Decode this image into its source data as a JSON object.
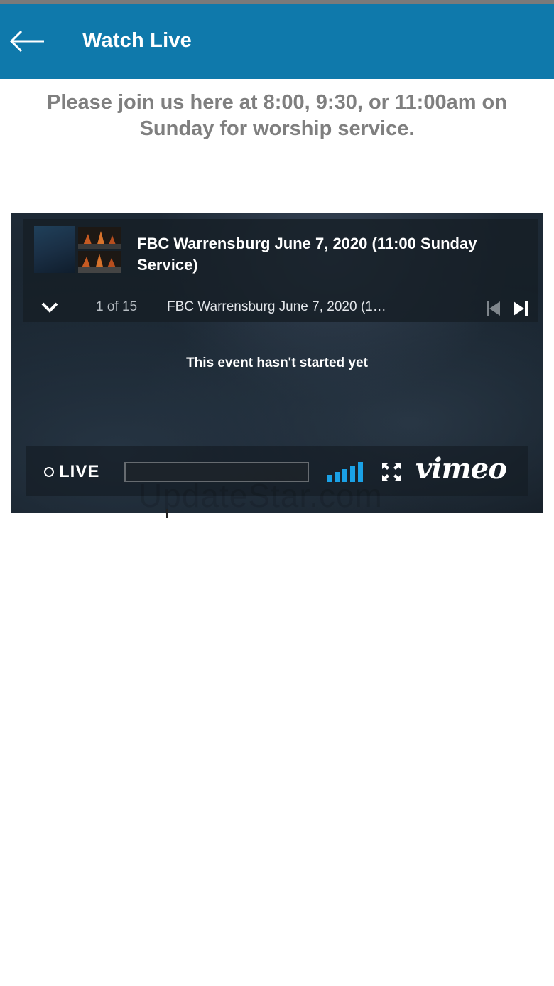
{
  "app_bar": {
    "title": "Watch Live",
    "back_icon": "arrow-left-icon",
    "bg_color": "#0f79ab"
  },
  "intro_text": "Please join us here at 8:00, 9:30, or 11:00am on Sunday for worship service.",
  "player": {
    "video_title": "FBC Warrensburg June 7, 2020 (11:00 Sunday Service)",
    "playlist_counter": "1 of 15",
    "playlist_item_title": "FBC Warrensburg June 7, 2020 (1…",
    "status_message": "This event hasn't started yet",
    "live_label": "LIVE",
    "brand": "vimeo",
    "icons": {
      "expand": "chevron-down-icon",
      "previous": "skip-previous-icon",
      "next": "skip-next-icon",
      "signal": "signal-strength-icon",
      "fullscreen": "fullscreen-icon"
    },
    "accent_color": "#1aa1e6"
  },
  "watermark": "UpdateStar.com"
}
